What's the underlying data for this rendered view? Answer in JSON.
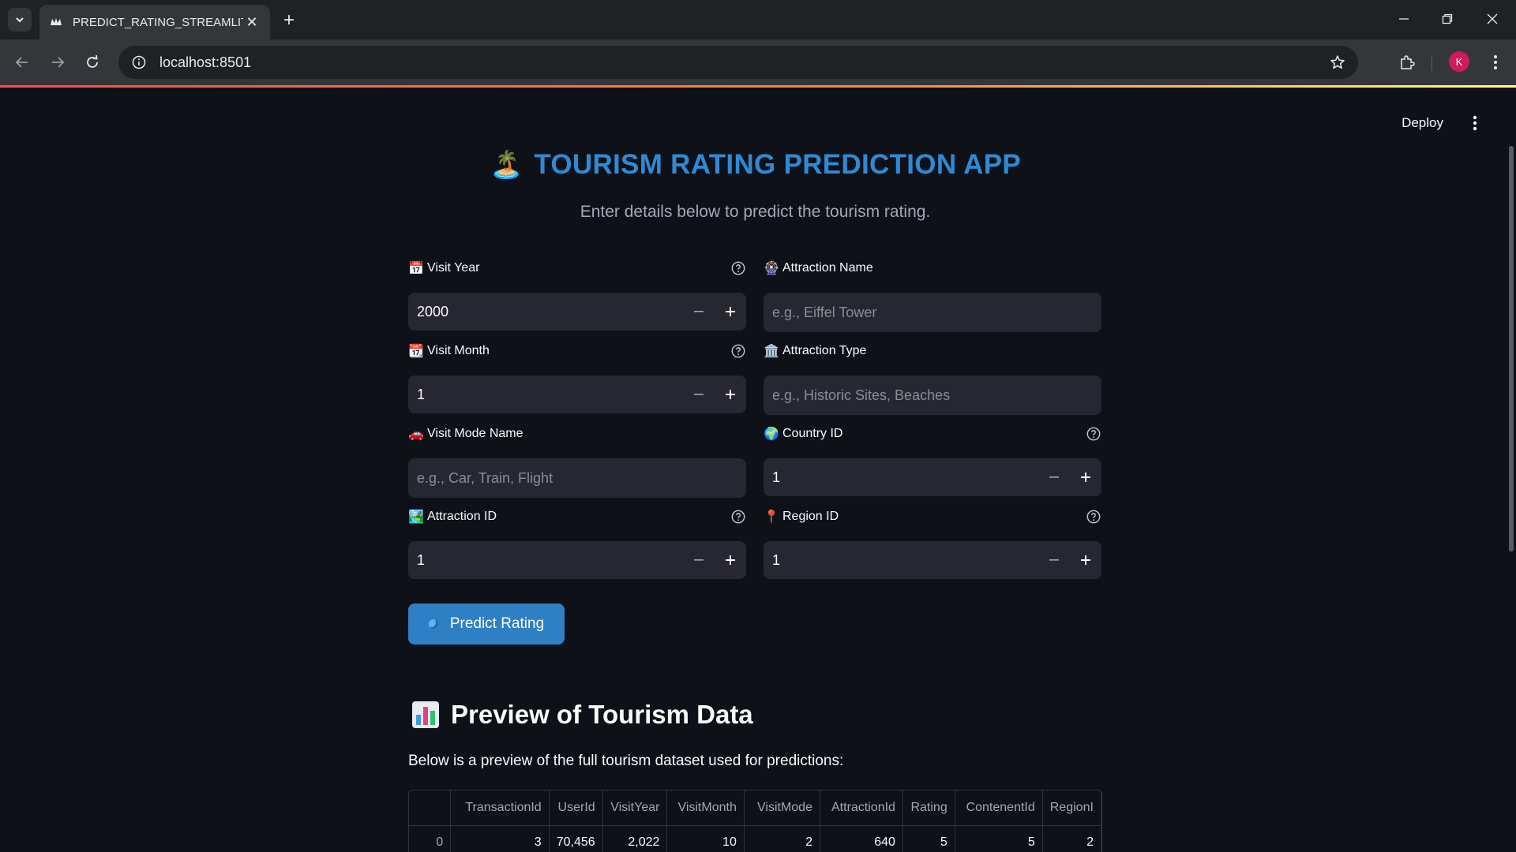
{
  "browser": {
    "tab_title": "PREDICT_RATING_STREAMLIT",
    "url": "localhost:8501",
    "profile_initial": "K"
  },
  "app": {
    "deploy_label": "Deploy",
    "title_emoji": "🏝️",
    "title": "TOURISM RATING PREDICTION APP",
    "subtitle": "Enter details below to predict the tourism rating.",
    "fields": {
      "visit_year": {
        "emoji": "📅",
        "label": "Visit Year",
        "value": "2000"
      },
      "attraction_name": {
        "emoji": "🎡",
        "label": "Attraction Name",
        "placeholder": "e.g., Eiffel Tower"
      },
      "visit_month": {
        "emoji": "📆",
        "label": "Visit Month",
        "value": "1"
      },
      "attraction_type": {
        "emoji": "🏛️",
        "label": "Attraction Type",
        "placeholder": "e.g., Historic Sites, Beaches"
      },
      "visit_mode_name": {
        "emoji": "🚗",
        "label": "Visit Mode Name",
        "placeholder": "e.g., Car, Train, Flight"
      },
      "country_id": {
        "emoji": "🌍",
        "label": "Country ID",
        "value": "1"
      },
      "attraction_id": {
        "emoji": "🏞️",
        "label": "Attraction ID",
        "value": "1"
      },
      "region_id": {
        "emoji": "📍",
        "label": "Region ID",
        "value": "1"
      }
    },
    "predict_label": "Predict Rating",
    "preview_title": "Preview of Tourism Data",
    "preview_desc": "Below is a preview of the full tourism dataset used for predictions:",
    "table": {
      "columns": [
        "",
        "TransactionId",
        "UserId",
        "VisitYear",
        "VisitMonth",
        "VisitMode",
        "AttractionId",
        "Rating",
        "ContenentId",
        "RegionI"
      ],
      "rows": [
        [
          "0",
          "3",
          "70,456",
          "2,022",
          "10",
          "2",
          "640",
          "5",
          "5",
          "2"
        ]
      ]
    }
  }
}
